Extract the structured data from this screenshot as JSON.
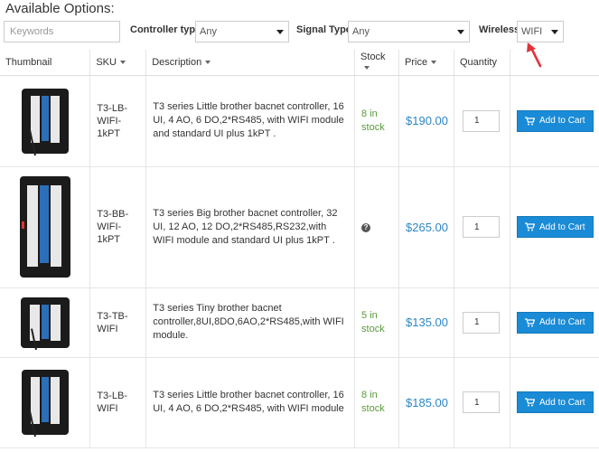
{
  "page": {
    "title": "Available Options:"
  },
  "filters": {
    "keywords_placeholder": "Keywords",
    "controller_label": "Controller type",
    "controller_value": "Any",
    "signal_label": "Signal Type",
    "signal_value": "Any",
    "wireless_label": "Wireless",
    "wireless_value": "WIFI"
  },
  "table": {
    "headers": {
      "thumbnail": "Thumbnail",
      "sku": "SKU",
      "description": "Description",
      "stock": "Stock",
      "price": "Price",
      "quantity": "Quantity"
    },
    "rows": [
      {
        "sku": "T3-LB-WIFI-1kPT",
        "description": "T3 series Little brother bacnet controller, 16 UI, 4 AO, 6 DO,2*RS485, with WIFI module and standard UI plus 1kPT .",
        "stock": "8 in stock",
        "price": "$190.00",
        "qty": "1",
        "cart": "Add to Cart"
      },
      {
        "sku": "T3-BB-WIFI-1kPT",
        "description": "T3 series Big brother bacnet controller, 32 UI, 12 AO, 12 DO,2*RS485,RS232,with WIFI module and standard UI plus 1kPT .",
        "stock": "?",
        "price": "$265.00",
        "qty": "1",
        "cart": "Add to Cart"
      },
      {
        "sku": "T3-TB-WIFI",
        "description": "T3 series Tiny brother bacnet controller,8UI,8DO,6AO,2*RS485,with WIFI module.",
        "stock": "5 in stock",
        "price": "$135.00",
        "qty": "1",
        "cart": "Add to Cart"
      },
      {
        "sku": "T3-LB-WIFI",
        "description": "T3 series Little brother bacnet controller, 16 UI, 4 AO, 6 DO,2*RS485, with WIFI module",
        "stock": "8 in stock",
        "price": "$185.00",
        "qty": "1",
        "cart": "Add to Cart"
      }
    ]
  },
  "colors": {
    "accent": "#1a8bd6",
    "price": "#2c87c5",
    "in_stock": "#5b9a3c",
    "annotation_arrow": "#e0343a"
  },
  "icons": {
    "cart": "cart-icon",
    "help": "question-circle-icon",
    "dropdown": "caret-down-icon",
    "sort": "sort-caret-icon"
  }
}
